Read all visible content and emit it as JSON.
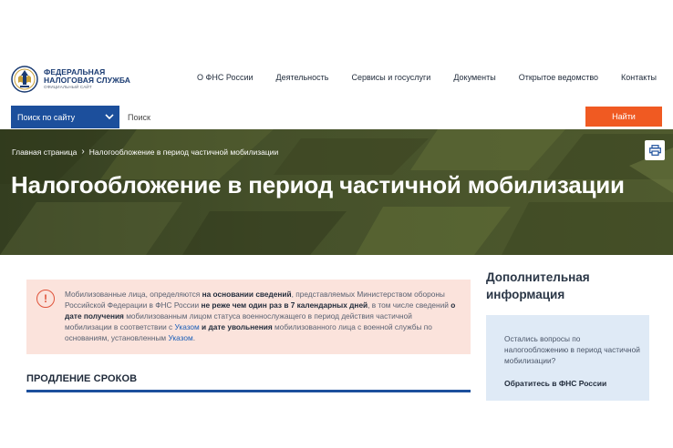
{
  "header": {
    "logo_line1": "ФЕДЕРАЛЬНАЯ",
    "logo_line2": "НАЛОГОВАЯ СЛУЖБА",
    "logo_line3": "ОФИЦИАЛЬНЫЙ САЙТ",
    "nav": [
      {
        "label": "О ФНС России"
      },
      {
        "label": "Деятельность"
      },
      {
        "label": "Сервисы и госуслуги"
      },
      {
        "label": "Документы"
      },
      {
        "label": "Открытое ведомство"
      },
      {
        "label": "Контакты"
      }
    ]
  },
  "search": {
    "scope_label": "Поиск по сайту",
    "placeholder": "Поиск",
    "button_label": "Найти"
  },
  "breadcrumb": {
    "home": "Главная страница",
    "separator": "›",
    "current": "Налогообложение в период частичной мобилизации"
  },
  "page": {
    "title": "Налогообложение в период частичной мобилизации"
  },
  "notice": {
    "icon": "!",
    "t1": "Мобилизованные лица, определяются ",
    "b1": "на основании сведений",
    "t2": ", представляемых Министерством обороны Российской Федерации в ФНС России ",
    "b2": "не реже чем один раз в 7 календарных дней",
    "t3": ", в том числе сведений ",
    "b3": "о дате получения",
    "t4": " мобилизованным лицом статуса военнослужащего в период действия частичной мобилизации в соответствии с ",
    "link1": "Указом",
    "b4": " и дате увольнения",
    "t5": " мобилизованного лица с военной службы по основаниям, установленным ",
    "link2": "Указом",
    "t6": "."
  },
  "section": {
    "title": "ПРОДЛЕНИЕ СРОКОВ"
  },
  "sidebar": {
    "title": "Дополнительная информация",
    "question": "Остались вопросы по налогообложению в период частичной мобилизации?",
    "link": "Обратитесь в ФНС России"
  },
  "colors": {
    "brand_blue": "#1c4f9c",
    "accent_orange": "#f05a22",
    "hero_olive": "#45502a",
    "notice_bg": "#fbe3dc",
    "sidebar_card_bg": "#dfeaf6"
  },
  "icons": {
    "logo": "fns-emblem-icon",
    "scope_dropdown": "chevron-down-icon",
    "breadcrumb_separator": "chevron-right-icon",
    "print": "printer-icon",
    "notice": "exclamation-circle-icon"
  }
}
